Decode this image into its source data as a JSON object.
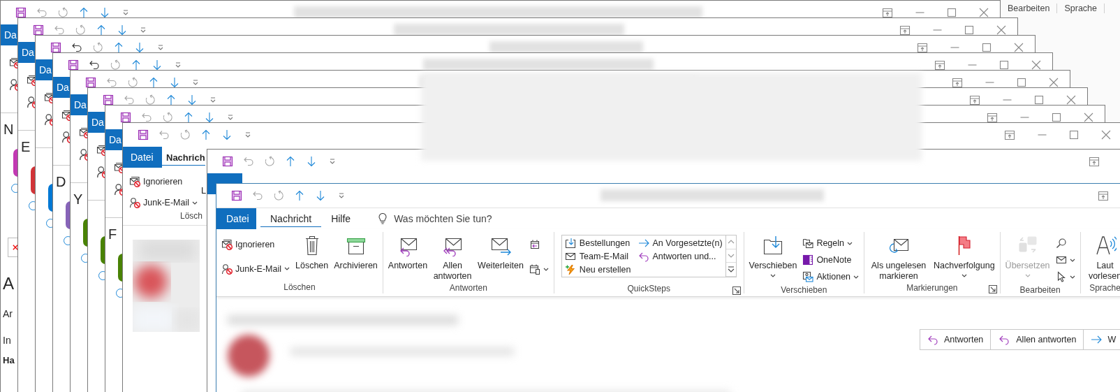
{
  "background_window": {
    "group_labels": [
      "Bearbeiten",
      "Sprache"
    ]
  },
  "stacked_window_toolbars": [
    {
      "undo_enabled": false
    },
    {
      "undo_enabled": false
    },
    {
      "undo_enabled": true
    },
    {
      "undo_enabled": true
    },
    {
      "undo_enabled": false
    },
    {
      "undo_enabled": false
    },
    {
      "undo_enabled": false
    }
  ],
  "stacked_windows": [
    {
      "tab_label": "Da",
      "heading": "N",
      "color": "#c239b3",
      "detail_lines": [
        {
          "text": "A",
          "kind": "title"
        },
        {
          "text": "Ar",
          "kind": "plain"
        },
        {
          "text": "In",
          "kind": "plain"
        },
        {
          "text": "Ha",
          "kind": "bold"
        }
      ]
    },
    {
      "tab_label": "Da",
      "heading": "E",
      "color": "#d13438"
    },
    {
      "tab_label": "Da",
      "color": "#0078d4"
    },
    {
      "tab_label": "Da",
      "heading": "D",
      "color": "#8764b8"
    },
    {
      "tab_label": "Da",
      "heading": "Y",
      "color": "#498205"
    },
    {
      "tab_label": "Da",
      "color": "#498205"
    },
    {
      "tab_label": "Da",
      "heading": "F",
      "color": "#498205"
    }
  ],
  "middle_window": {
    "undo_enabled": false,
    "tabs": [
      {
        "label": "Datei",
        "kind": "file",
        "selected": false
      },
      {
        "label": "Nachrich",
        "kind": "tab",
        "selected": true
      }
    ],
    "ribbon_items": [
      {
        "label": "Ignorieren",
        "has_menu": false
      },
      {
        "label": "Junk-E-Mail",
        "has_menu": true
      }
    ],
    "cut_button": {
      "label": "L"
    },
    "group_label": "Lösch"
  },
  "partly_hidden_window": {
    "undo_enabled": false
  },
  "front_window": {
    "undo_enabled": false,
    "redo_enabled": false,
    "tabs": [
      {
        "label": "Datei",
        "kind": "file",
        "selected": false
      },
      {
        "label": "Nachricht",
        "kind": "tab",
        "selected": true
      },
      {
        "label": "Hilfe",
        "kind": "tab",
        "selected": false
      }
    ],
    "tell_me": {
      "placeholder": "Was möchten Sie tun?"
    },
    "ribbon_groups": [
      {
        "label": "Löschen",
        "launcher": false,
        "items": [
          {
            "kind": "small",
            "label": "Ignorieren",
            "has_menu": false,
            "disabled": false
          },
          {
            "kind": "small",
            "label": "Junk-E-Mail",
            "has_menu": true,
            "disabled": false
          },
          {
            "kind": "large",
            "label": "Löschen",
            "has_menu": false,
            "disabled": false
          },
          {
            "kind": "large",
            "label": "Archivieren",
            "has_menu": false,
            "disabled": false
          }
        ]
      },
      {
        "label": "Antworten",
        "launcher": false,
        "items": [
          {
            "kind": "large",
            "label": "Antworten",
            "has_menu": false,
            "disabled": false
          },
          {
            "kind": "large",
            "label": "Allen antworten",
            "has_menu": false,
            "disabled": false
          },
          {
            "kind": "large",
            "label": "Weiterleiten",
            "has_menu": false,
            "disabled": false
          },
          {
            "kind": "small",
            "has_menu": false,
            "disabled": false
          },
          {
            "kind": "small",
            "has_menu": true,
            "disabled": false
          }
        ]
      },
      {
        "label": "QuickSteps",
        "launcher": true,
        "items": [
          {
            "kind": "gallery",
            "entries": [
              {
                "label": "Bestellungen"
              },
              {
                "label": "Team-E-Mail"
              },
              {
                "label": "Neu erstellen"
              },
              {
                "label": "An Vorgesetzte(n)"
              },
              {
                "label": "Antworten und..."
              }
            ]
          }
        ]
      },
      {
        "label": "Verschieben",
        "launcher": false,
        "items": [
          {
            "kind": "large",
            "label": "Verschieben",
            "has_menu": true,
            "disabled": false
          },
          {
            "kind": "small",
            "label": "Regeln",
            "has_menu": true,
            "disabled": false
          },
          {
            "kind": "small",
            "label": "OneNote",
            "has_menu": false,
            "disabled": false
          },
          {
            "kind": "small",
            "label": "Aktionen",
            "has_menu": true,
            "disabled": false
          }
        ]
      },
      {
        "label": "Markierungen",
        "launcher": true,
        "items": [
          {
            "kind": "large",
            "label": "Als ungelesen markieren",
            "has_menu": false,
            "disabled": false
          },
          {
            "kind": "large",
            "label": "Nachverfolgung",
            "has_menu": true,
            "disabled": false
          }
        ]
      },
      {
        "label": "Bearbeiten",
        "launcher": false,
        "items": [
          {
            "kind": "large",
            "label": "Übersetzen",
            "has_menu": true,
            "disabled": true
          },
          {
            "kind": "small",
            "has_menu": false,
            "disabled": false
          },
          {
            "kind": "small",
            "has_menu": true,
            "disabled": false
          },
          {
            "kind": "small",
            "has_menu": true,
            "disabled": false
          }
        ]
      },
      {
        "label": "Sprache",
        "launcher": false,
        "items": [
          {
            "kind": "large",
            "label": "Laut vorlesen",
            "has_menu": false,
            "disabled": false
          }
        ]
      }
    ],
    "reply_bar": [
      {
        "label": "Antworten",
        "kind": "reply"
      },
      {
        "label": "Allen antworten",
        "kind": "reply_all"
      },
      {
        "label": "W",
        "kind": "forward"
      }
    ]
  }
}
